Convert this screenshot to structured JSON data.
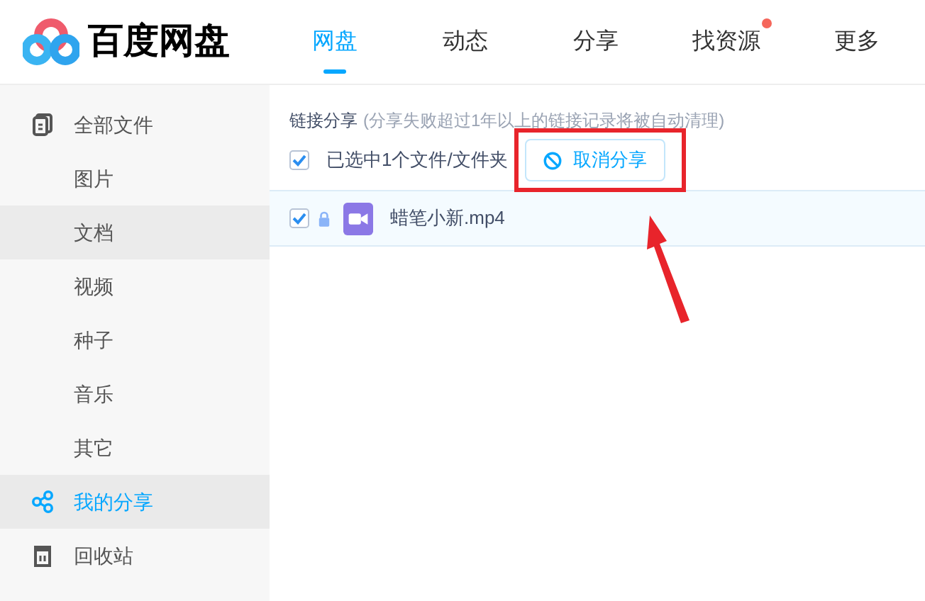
{
  "logo": {
    "text": "百度网盘"
  },
  "nav_tabs": [
    {
      "label": "网盘",
      "selected": true,
      "badge": false
    },
    {
      "label": "动态",
      "selected": false,
      "badge": false
    },
    {
      "label": "分享",
      "selected": false,
      "badge": false
    },
    {
      "label": "找资源",
      "selected": false,
      "badge": true
    },
    {
      "label": "更多",
      "selected": false,
      "badge": false
    }
  ],
  "sidebar": {
    "items": [
      {
        "label": "全部文件",
        "kind": "files",
        "selected": false,
        "hovered": false
      },
      {
        "label": "图片",
        "kind": "category",
        "selected": false,
        "hovered": false
      },
      {
        "label": "文档",
        "kind": "category",
        "selected": false,
        "hovered": true
      },
      {
        "label": "视频",
        "kind": "category",
        "selected": false,
        "hovered": false
      },
      {
        "label": "种子",
        "kind": "category",
        "selected": false,
        "hovered": false
      },
      {
        "label": "音乐",
        "kind": "category",
        "selected": false,
        "hovered": false
      },
      {
        "label": "其它",
        "kind": "category",
        "selected": false,
        "hovered": false
      },
      {
        "label": "我的分享",
        "kind": "share",
        "selected": true,
        "hovered": false
      },
      {
        "label": "回收站",
        "kind": "trash",
        "selected": false,
        "hovered": false
      }
    ]
  },
  "content": {
    "title": "链接分享",
    "note": "(分享失败超过1年以上的链接记录将被自动清理)",
    "select_all": {
      "checked": true,
      "label": "已选中1个文件/文件夹"
    },
    "cancel_button": {
      "label": "取消分享"
    },
    "files": [
      {
        "name": "蜡笔小新.mp4",
        "checked": true,
        "locked": true,
        "kind": "video"
      }
    ]
  }
}
